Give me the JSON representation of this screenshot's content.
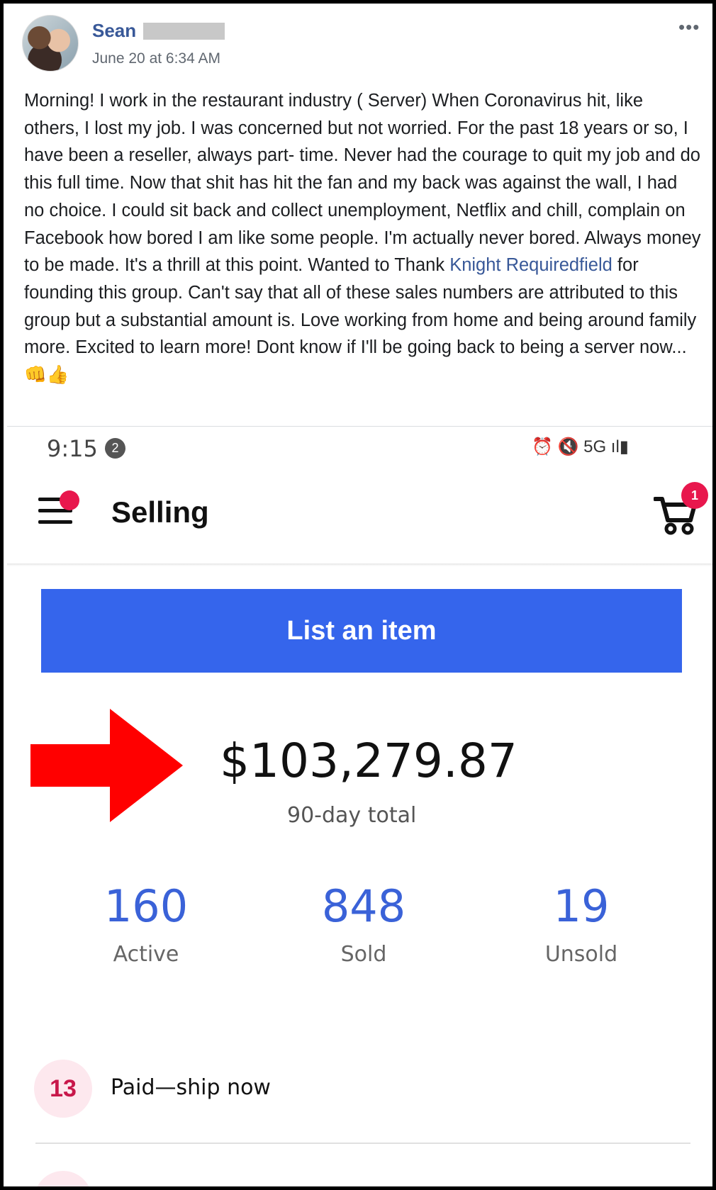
{
  "post": {
    "author": "Sean",
    "time": "June 20 at 6:34 AM",
    "more": "•••",
    "body_before": "Morning! I work in the restaurant industry ( Server) When Coronavirus hit, like others, I lost my job. I was concerned but not worried. For the past 18 years or so, I have been a reseller, always part- time. Never had the courage to quit my job and do this full time. Now that shit has hit the fan and my back was against the wall, I had no choice. I could sit back and collect unemployment, Netflix and chill, complain on Facebook how bored I am like some people. I'm actually never bored. Always money to be made. It's a thrill at this point. Wanted to Thank ",
    "mention": "Knight Requiredfield",
    "body_after": " for founding this group. Can't say that all of these sales numbers are attributed to this group but a substantial amount is. Love working from home and being around family more. Excited to learn more! Dont know if I'll be going back to being a server now...👊👍"
  },
  "screenshot": {
    "status_bar": {
      "time": "9:15",
      "notification_count": "2",
      "icons_text": "⏰ 🔇 5G ıl▮"
    },
    "app_bar": {
      "title": "Selling",
      "cart_count": "1"
    },
    "list_button_label": "List an item",
    "total": "$103,279.87",
    "total_label": "90-day total",
    "stats": [
      {
        "value": "160",
        "label": "Active"
      },
      {
        "value": "848",
        "label": "Sold"
      },
      {
        "value": "19",
        "label": "Unsold"
      }
    ],
    "paid_count": "13",
    "paid_label": "Paid—ship now",
    "colors": {
      "primary_button": "#3565ec",
      "stat_number": "#3a62d8",
      "badge": "#e8174d",
      "annotation_arrow": "#ff0000"
    }
  }
}
